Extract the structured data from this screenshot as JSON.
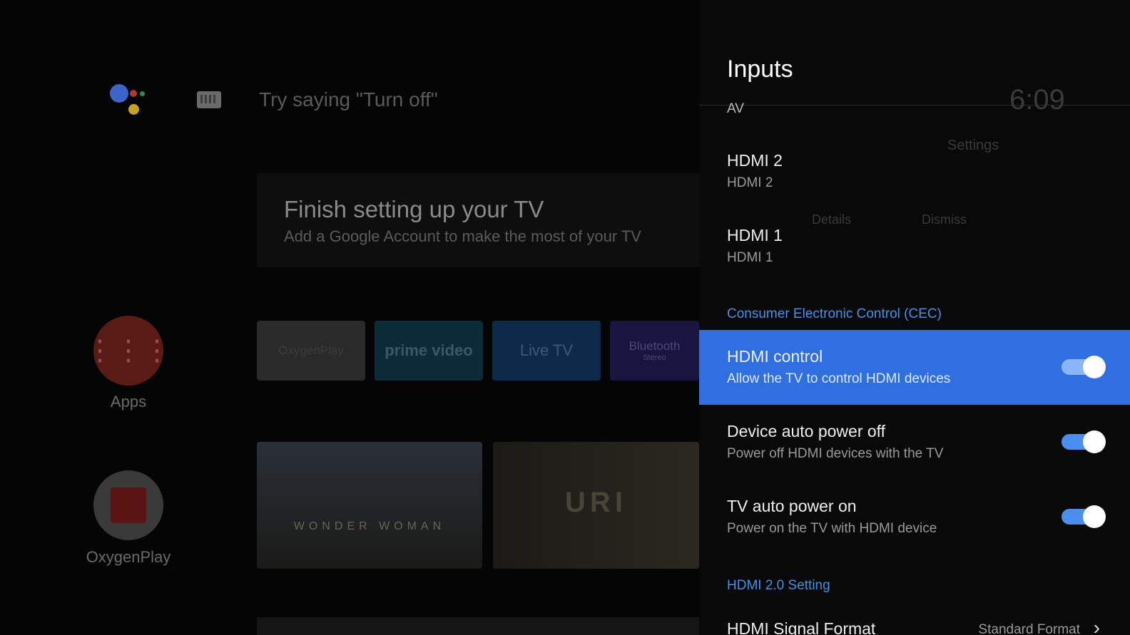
{
  "home": {
    "hint": "Try saying \"Turn off\"",
    "card_title": "Finish setting up your TV",
    "card_subtitle": "Add a Google Account to make the most of your TV",
    "apps_label": "Apps",
    "oxygenplay_label": "OxygenPlay",
    "tiles": [
      "OxygenPlay",
      "prime video",
      "Live TV",
      "Bluetooth"
    ],
    "tile_sub": "Stereo",
    "posters": [
      "WONDER WOMAN",
      "URI"
    ],
    "clock": "6:09",
    "settings_label": "Settings",
    "card_buttons": [
      "Details",
      "Dismiss"
    ]
  },
  "panel": {
    "title": "Inputs",
    "items": [
      {
        "main": "AV"
      },
      {
        "main": "HDMI 2",
        "desc": "HDMI 2"
      },
      {
        "main": "HDMI 1",
        "desc": "HDMI 1"
      }
    ],
    "sec_cec": "Consumer Electronic Control (CEC)",
    "toggles": [
      {
        "main": "HDMI control",
        "desc": "Allow the TV to control HDMI devices",
        "on": true
      },
      {
        "main": "Device auto power off",
        "desc": "Power off HDMI devices with the TV",
        "on": true
      },
      {
        "main": "TV auto power on",
        "desc": "Power on the TV with HDMI device",
        "on": true
      }
    ],
    "sec_hdmi20": "HDMI 2.0 Setting",
    "signal": {
      "main": "HDMI Signal Format",
      "value": "Standard Format"
    }
  }
}
